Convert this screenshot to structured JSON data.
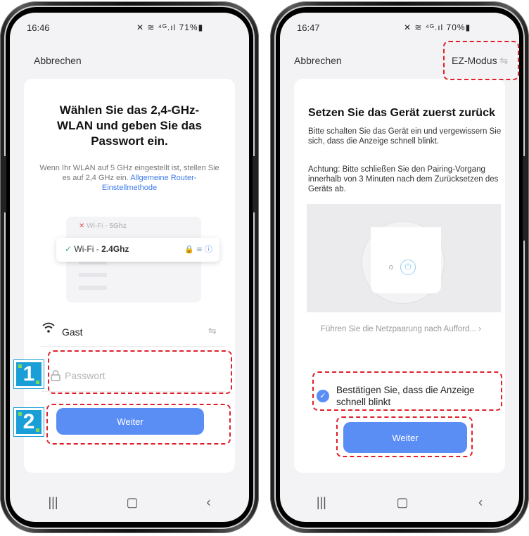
{
  "left": {
    "status": {
      "time": "16:46",
      "icons": "✕ ≋ ⁴ᴳ.ıl 71%▮"
    },
    "cancel": "Abbrechen",
    "heading": "Wählen Sie das 2,4-GHz-WLAN und geben Sie das Passwort ein.",
    "info_text": "Wenn Ihr WLAN auf 5 GHz eingestellt ist, stellen Sie es auf 2,4 GHz ein.",
    "info_link": "Allgemeine Router-Einstellmethode",
    "wifi_5g_prefix": "Wi-Fi - ",
    "wifi_5g_band": "5Ghz",
    "wifi_24_prefix": "Wi-Fi - ",
    "wifi_24_band": "2.4Ghz",
    "network_name": "Gast",
    "password_placeholder": "Passwort",
    "button": "Weiter",
    "step1": "1",
    "step2": "2"
  },
  "right": {
    "status": {
      "time": "16:47",
      "icons": "✕ ≋ ⁴ᴳ.ıl 70%▮"
    },
    "cancel": "Abbrechen",
    "mode": "EZ-Modus",
    "title": "Setzen Sie das Gerät zuerst zurück",
    "paragraph1": "Bitte schalten Sie das Gerät ein und vergewissern Sie sich, dass die Anzeige schnell blinkt.",
    "paragraph2": "Achtung: Bitte schließen Sie den Pairing-Vorgang innerhalb von 3 Minuten nach dem Zurücksetzen des Geräts ab.",
    "guide_link": "Führen Sie die Netzpaarung nach Aufford...",
    "confirm": "Bestätigen Sie, dass die Anzeige schnell blinkt",
    "button": "Weiter"
  },
  "colors": {
    "accent": "#5b8ef5",
    "highlight": "#e0202a",
    "badge": "#1a9ed8"
  }
}
